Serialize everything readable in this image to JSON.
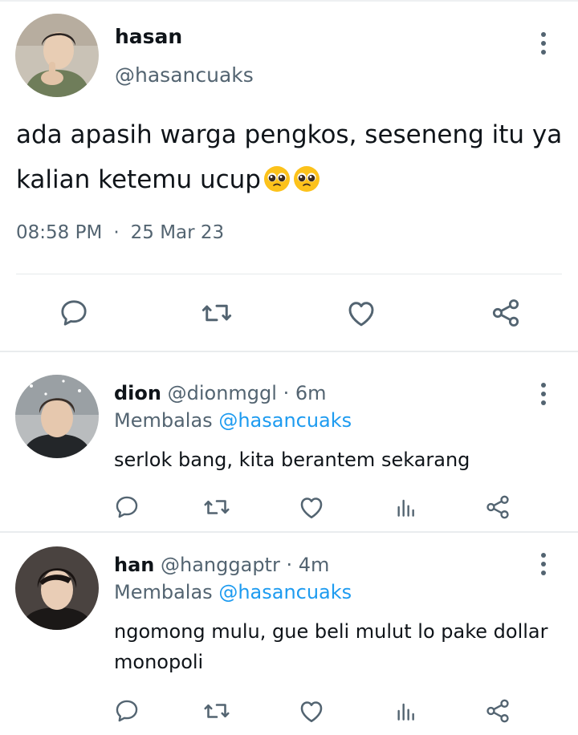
{
  "tweet": {
    "name": "hasan",
    "handle": "@hasancuaks",
    "text": "ada apasih warga pengkos, seseneng itu ya kalian ketemu ucup",
    "emoji": "pleading-face-emoji",
    "time": "08:58 PM",
    "separator": "·",
    "date": "25 Mar 23"
  },
  "replies": [
    {
      "name": "dion",
      "handle": "@dionmggl",
      "age": "· 6m",
      "replying_prefix": "Membalas",
      "replying_to": "@hasancuaks",
      "text": "serlok bang, kita berantem sekarang"
    },
    {
      "name": "han",
      "handle": "@hanggaptr",
      "age": "· 4m",
      "replying_prefix": "Membalas",
      "replying_to": "@hasancuaks",
      "text": "ngomong mulu, gue beli mulut lo pake dollar monopoli"
    }
  ],
  "colors": {
    "text": "#0f1419",
    "secondary": "#536471",
    "mention": "#1d9bf0",
    "divider": "#e6e9eb"
  },
  "icons": {
    "actions": [
      "reply-icon",
      "retweet-icon",
      "like-icon",
      "share-icon"
    ],
    "reply_actions": [
      "reply-icon",
      "retweet-icon",
      "like-icon",
      "analytics-icon",
      "share-icon"
    ],
    "menu": "more-vertical-icon"
  }
}
